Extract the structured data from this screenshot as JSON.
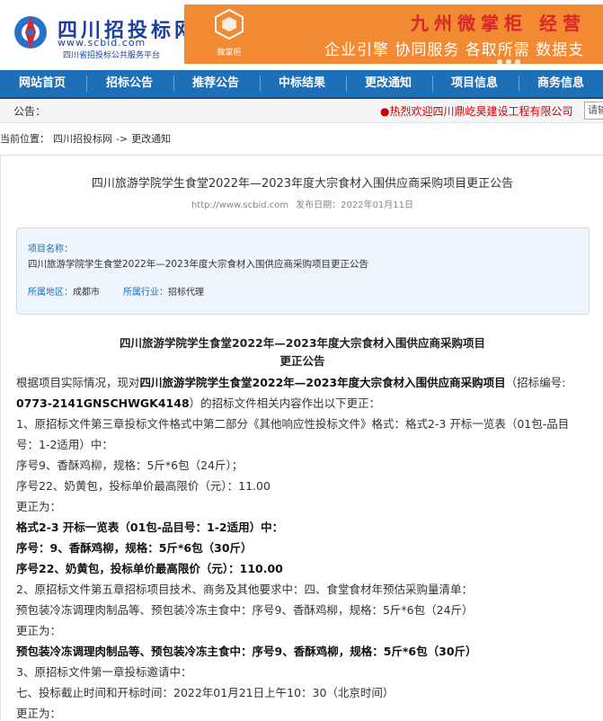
{
  "header": {
    "logo_name": "四川招投标网",
    "logo_url": "www.scbid.com",
    "logo_sub": "四川省招投标公共服务平台",
    "banner_logo_text": "微掌柜",
    "banner_title": "九州微掌柜  经营",
    "banner_tag": "企业引擎 协同服务 各取所需  数据支"
  },
  "nav": {
    "items": [
      "网站首页",
      "招标公告",
      "推荐公告",
      "中标结果",
      "更改通知",
      "项目信息",
      "商务信息"
    ]
  },
  "notice": {
    "label": "公告：",
    "marquee": "●热烈欢迎四川鼎屹昊建设工程有限公司",
    "button": "请输"
  },
  "breadcrumb": {
    "prefix": "当前位置：",
    "home": "四川招投标网",
    "arrow": "->",
    "current": "更改通知"
  },
  "article": {
    "title": "四川旅游学院学生食堂2022年—2023年度大宗食材入围供应商采购项目更正公告",
    "url": "http://www.scbid.com",
    "date_label": "发布日期：",
    "date": "2022年01月11日",
    "info": {
      "name_label": "项目名称：",
      "name": "四川旅游学院学生食堂2022年—2023年度大宗食材入围供应商采购项目更正公告",
      "region_label": "所属地区：",
      "region": "成都市",
      "industry_label": "所属行业：",
      "industry": "招标代理"
    },
    "heading1": "四川旅游学院学生食堂2022年—2023年度大宗食材入围供应商采购项目",
    "heading2": "更正公告",
    "p1_a": "根据项目实际情况，现对",
    "p1_b": "四川旅游学院学生食堂2022年—2023年度大宗食材入围供应商采购项目",
    "p1_c": "（招标编号:",
    "p2_a": "0773-2141GNSCHWGK4148",
    "p2_b": "）的招标文件相关内容作出以下更正：",
    "l3": "1、原招标文件第三章投标文件格式中第二部分《其他响应性投标文件》格式：格式2-3 开标一览表（01包-品目",
    "l4": "号：1-2适用）中：",
    "l5": "序号9、香酥鸡柳，规格：5斤*6包（24斤）；",
    "l6": "序号22、奶黄包，投标单价最高限价（元）：11.00",
    "l7": "更正为：",
    "l8": "格式2-3 开标一览表（01包-品目号：1-2适用）中：",
    "l9": "序号：9、香酥鸡柳，规格：5斤*6包（30斤）",
    "l10": "序号22、奶黄包，投标单价最高限价（元）：110.00",
    "l11": "2、原招标文件第五章招标项目技术、商务及其他要求中：四、食堂食材年预估采购量清单：",
    "l12": "预包装冷冻调理肉制品等、预包装冷冻主食中：序号9、香酥鸡柳，规格：5斤*6包（24斤）",
    "l13": "更正为：",
    "l14": "预包装冷冻调理肉制品等、预包装冷冻主食中：序号9、香酥鸡柳，规格：5斤*6包（30斤）",
    "l15": "3、原招标文件第一章投标邀请中：",
    "l16": "七、投标截止时间和开标时间：2022年01月21日上午10：30（北京时间）",
    "l17": "更正为："
  },
  "colors": {
    "nav_bg": "#1d6fb8",
    "brand": "#1a3f9c",
    "banner_bg": "#f28a33",
    "marquee": "#cc0000"
  }
}
